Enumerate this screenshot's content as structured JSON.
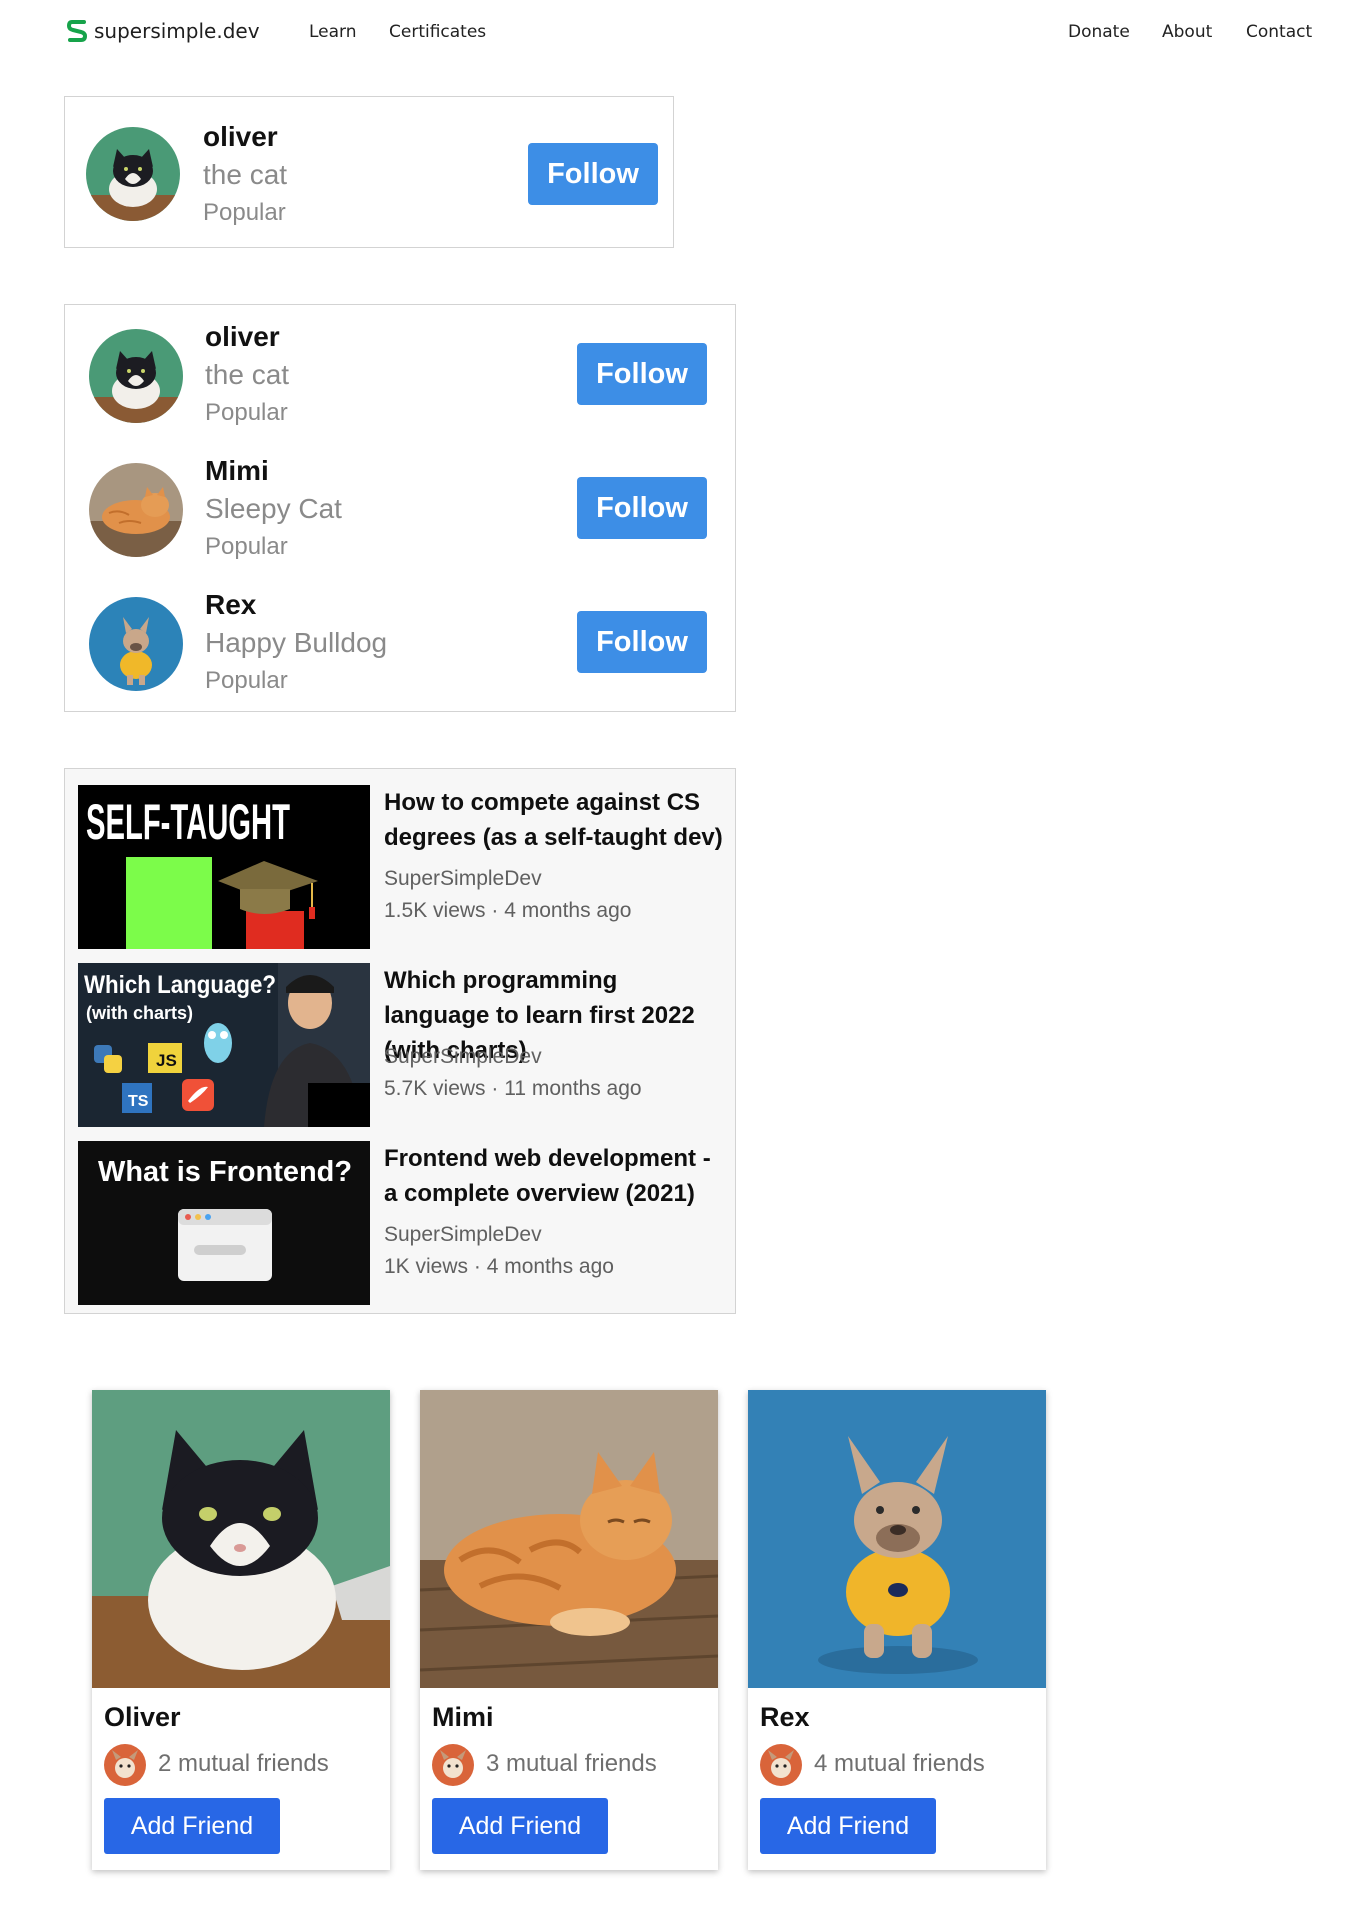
{
  "nav": {
    "logo_text": "supersimple.dev",
    "links": [
      "Learn",
      "Certificates"
    ],
    "right_links": [
      "Donate",
      "About",
      "Contact"
    ]
  },
  "single_profile": {
    "name": "oliver",
    "description": "the cat",
    "meta": "Popular",
    "button": "Follow"
  },
  "profiles": [
    {
      "name": "oliver",
      "description": "the cat",
      "meta": "Popular",
      "button": "Follow"
    },
    {
      "name": "Mimi",
      "description": "Sleepy Cat",
      "meta": "Popular",
      "button": "Follow"
    },
    {
      "name": "Rex",
      "description": "Happy Bulldog",
      "meta": "Popular",
      "button": "Follow"
    }
  ],
  "videos": [
    {
      "thumb_text": "SELF-TAUGHT",
      "title": "How to compete against CS degrees (as a self-taught dev)",
      "channel": "SuperSimpleDev",
      "stats": "1.5K views · 4 months ago"
    },
    {
      "thumb_text": "Which Language?",
      "thumb_subtext": "(with charts)",
      "title": "Which programming language to learn first 2022 (with charts)",
      "channel": "SuperSimpleDev",
      "stats": "5.7K views · 11 months ago"
    },
    {
      "thumb_text": "What is Frontend?",
      "title": "Frontend web development - a complete overview (2021)",
      "channel": "SuperSimpleDev",
      "stats": "1K views · 4 months ago"
    }
  ],
  "friends": [
    {
      "name": "Oliver",
      "mutual": "2 mutual friends",
      "button": "Add Friend"
    },
    {
      "name": "Mimi",
      "mutual": "3 mutual friends",
      "button": "Add Friend"
    },
    {
      "name": "Rex",
      "mutual": "4 mutual friends",
      "button": "Add Friend"
    }
  ],
  "colors": {
    "follow_button": "#3d8ee6",
    "add_friend_button": "#2867e6",
    "logo_green": "#16a34a"
  }
}
